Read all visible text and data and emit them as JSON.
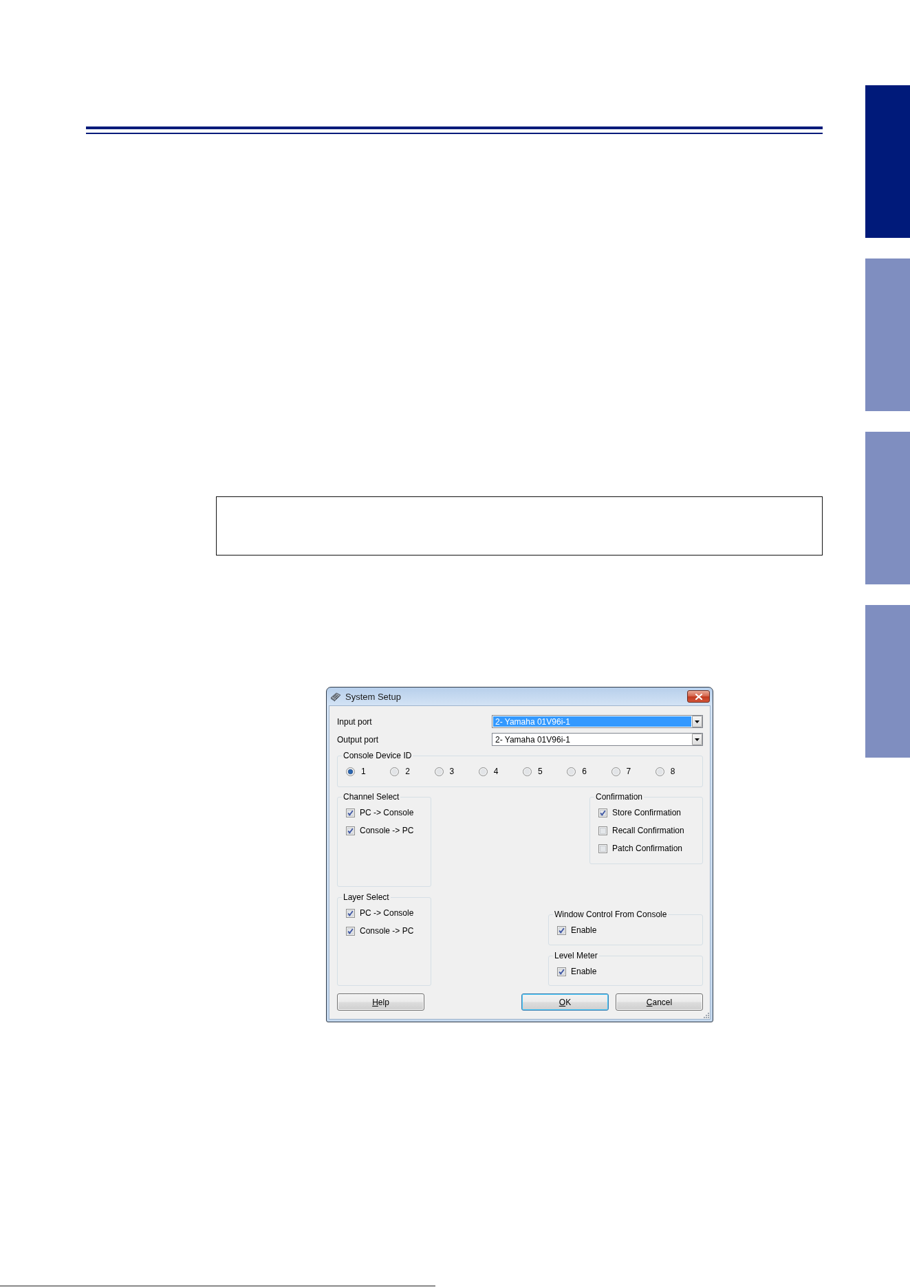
{
  "side_tabs": [
    {
      "selected": true
    },
    {
      "selected": false
    },
    {
      "selected": false
    },
    {
      "selected": false
    }
  ],
  "dialog": {
    "title": "System Setup",
    "input_port": {
      "label": "Input port",
      "value": "2- Yamaha 01V96i-1",
      "highlighted": true
    },
    "output_port": {
      "label": "Output port",
      "value": "2- Yamaha 01V96i-1",
      "highlighted": false
    },
    "console_device_id": {
      "title": "Console Device ID",
      "options": [
        {
          "label": "1",
          "selected": true
        },
        {
          "label": "2",
          "selected": false
        },
        {
          "label": "3",
          "selected": false
        },
        {
          "label": "4",
          "selected": false
        },
        {
          "label": "5",
          "selected": false
        },
        {
          "label": "6",
          "selected": false
        },
        {
          "label": "7",
          "selected": false
        },
        {
          "label": "8",
          "selected": false
        }
      ]
    },
    "channel_select": {
      "title": "Channel Select",
      "options": [
        {
          "label": "PC -> Console",
          "checked": true
        },
        {
          "label": "Console -> PC",
          "checked": true
        }
      ]
    },
    "confirmation": {
      "title": "Confirmation",
      "options": [
        {
          "label": "Store Confirmation",
          "checked": true
        },
        {
          "label": "Recall Confirmation",
          "checked": false
        },
        {
          "label": "Patch Confirmation",
          "checked": false
        }
      ]
    },
    "layer_select": {
      "title": "Layer Select",
      "options": [
        {
          "label": "PC -> Console",
          "checked": true
        },
        {
          "label": "Console -> PC",
          "checked": true
        }
      ]
    },
    "window_control": {
      "title": "Window Control From Console",
      "options": [
        {
          "label": "Enable",
          "checked": true
        }
      ]
    },
    "level_meter": {
      "title": "Level Meter",
      "options": [
        {
          "label": "Enable",
          "checked": true
        }
      ]
    },
    "buttons_left": [
      {
        "label": "Help",
        "default": false
      }
    ],
    "buttons_right": [
      {
        "label": "OK",
        "default": true
      },
      {
        "label": "Cancel",
        "default": false
      }
    ]
  }
}
